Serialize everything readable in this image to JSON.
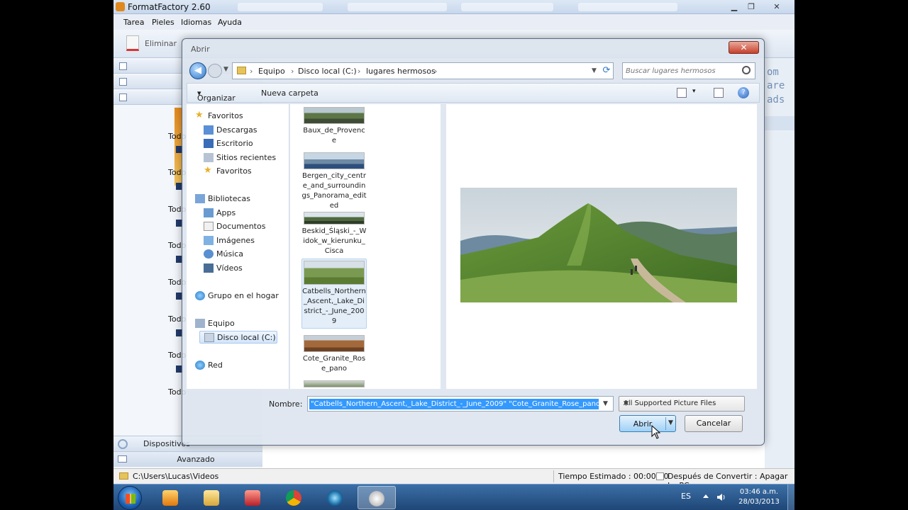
{
  "app": {
    "title": "FormatFactory 2.60",
    "menu": [
      "Tarea",
      "Pieles",
      "Idiomas",
      "Ayuda"
    ],
    "toolbar": {
      "delete_label": "Eliminar"
    },
    "sidebar": {
      "todo_label": "Todo",
      "bottom_items": [
        "Dispositivos",
        "Avanzado"
      ]
    },
    "right_cut_text": [
      "om",
      "are",
      "ads"
    ],
    "status": {
      "output_path": "C:\\Users\\Lucas\\Videos",
      "estimated_time": "Tiempo Estimado : 00:00:00",
      "after_convert": "Después de Convertir : Apagar La PC"
    }
  },
  "dialog": {
    "title": "Abrir",
    "breadcrumb": [
      "Equipo",
      "Disco local (C:)",
      "lugares hermosos"
    ],
    "search_placeholder": "Buscar lugares hermosos",
    "commands": {
      "organize": "Organizar",
      "new_folder": "Nueva carpeta"
    },
    "nav": {
      "favorites_header": "Favoritos",
      "favorites": [
        "Descargas",
        "Escritorio",
        "Sitios recientes",
        "Favoritos"
      ],
      "libraries_header": "Bibliotecas",
      "libraries": [
        "Apps",
        "Documentos",
        "Imágenes",
        "Música",
        "Vídeos"
      ],
      "homegroup": "Grupo en el hogar",
      "computer_header": "Equipo",
      "computer_items": [
        "Disco local (C:)"
      ],
      "network": "Red"
    },
    "files": [
      {
        "name": "Baux_de_Provence",
        "selected": false
      },
      {
        "name": "Bergen_city_centre_and_surroundings_Panorama_edited",
        "selected": false
      },
      {
        "name": "Beskid_Śląski_-_Widok_w_kierunku_Cisca",
        "selected": false
      },
      {
        "name": "Catbells_Northern_Ascent,_Lake_District_-_June_2009",
        "selected": true
      },
      {
        "name": "Cote_Granite_Rose_pano",
        "selected": false
      }
    ],
    "filename_label": "Nombre:",
    "filename_value": "\"Catbells_Northern_Ascent,_Lake_District_-_June_2009\" \"Cote_Granite_Rose_pano\"",
    "filetype": "All Supported Picture Files",
    "open_button": "Abrir",
    "cancel_button": "Cancelar",
    "close_glyph": "✕"
  },
  "taskbar": {
    "language": "ES",
    "time": "03:46 a.m.",
    "date": "28/03/2013"
  },
  "colors": {
    "taskbar": "#1f4677",
    "selection": "#3399ff",
    "close": "#c7402c"
  }
}
